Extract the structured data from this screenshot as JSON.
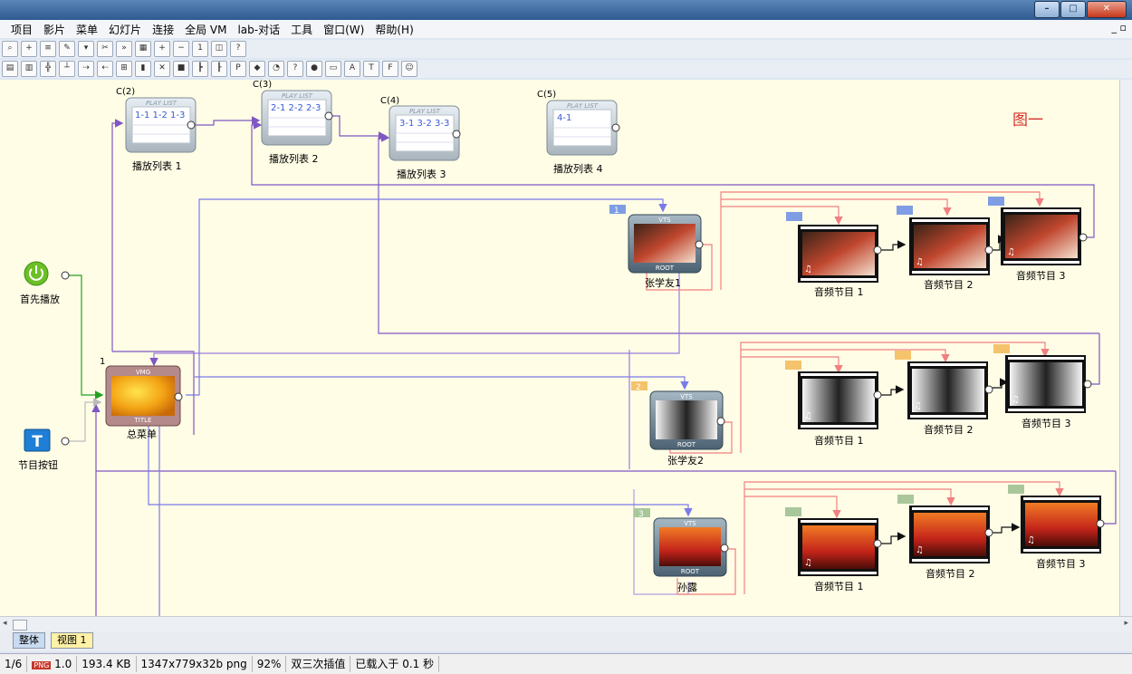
{
  "menu": {
    "items": [
      "项目",
      "影片",
      "菜单",
      "幻灯片",
      "连接",
      "全局 VM",
      "lab-对话",
      "工具",
      "窗口(W)",
      "帮助(H)"
    ]
  },
  "canvas": {
    "playlists": [
      {
        "code": "C(2)",
        "header": "PLAY LIST",
        "content": "1-1 1-2 1-3",
        "label": "播放列表 1"
      },
      {
        "code": "C(3)",
        "header": "PLAY LIST",
        "content": "2-1 2-2 2-3",
        "label": "播放列表 2"
      },
      {
        "code": "C(4)",
        "header": "PLAY LIST",
        "content": "3-1 3-2 3-3",
        "label": "播放列表 3"
      },
      {
        "code": "C(5)",
        "header": "PLAY LIST",
        "content": "4-1",
        "label": "播放列表 4"
      }
    ],
    "figure_label": "图一",
    "first_play_label": "首先播放",
    "title_button_glyph": "T",
    "title_button_label": "节目按钮",
    "vmg": {
      "number": "1",
      "top": "VMG",
      "bottom": "TITLE",
      "label": "总菜单"
    },
    "vts": [
      {
        "badge": "1",
        "top": "VTS",
        "bottom": "ROOT",
        "label": "张学友1",
        "badge_color": "#7f9de4"
      },
      {
        "badge": "2",
        "top": "VTS",
        "bottom": "ROOT",
        "label": "张学友2",
        "badge_color": "#f4c36b"
      },
      {
        "badge": "3",
        "top": "VTS",
        "bottom": "ROOT",
        "label": "孙露",
        "badge_color": "#a9c79a"
      }
    ],
    "audio_rows": [
      {
        "badge_color": "#7f9de4",
        "badge": "1",
        "items": [
          "音频节目 1",
          "音频节目 2",
          "音频节目 3"
        ]
      },
      {
        "badge_color": "#f4c36b",
        "badge": "2",
        "items": [
          "音频节目 1",
          "音频节目 2",
          "音频节目 3"
        ]
      },
      {
        "badge_color": "#a9c79a",
        "badge": "3",
        "items": [
          "音频节目 1",
          "音频节目 2",
          "音频节目 3"
        ]
      }
    ]
  },
  "tabs": {
    "whole": "整体",
    "view": "视图 1"
  },
  "status": {
    "page": "1/6",
    "format_icon": "PNG",
    "zoom_factor": "1.0",
    "filesize": "193.4 KB",
    "dims": "1347x779x32b png",
    "percent": "92%",
    "interp": "双三次插值",
    "loaded": "已载入于 0.1 秒"
  },
  "colors": {
    "canvas_bg": "#fffde6",
    "link_purple": "#7e57c2",
    "link_blue": "#7a7ae8",
    "link_red": "#f08080",
    "link_green": "#22a022"
  }
}
